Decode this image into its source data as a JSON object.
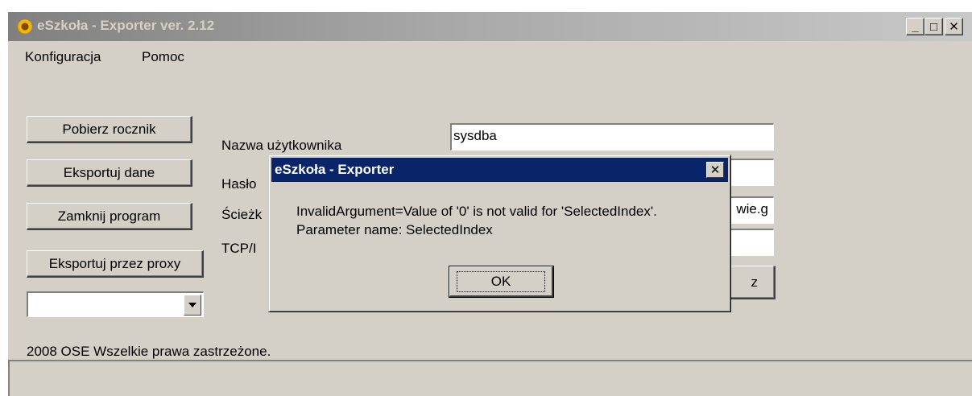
{
  "window": {
    "title": "eSzkoła - Exporter ver. 2.12",
    "icon": "sunflower-app-icon",
    "controls": {
      "minimize": "_",
      "maximize": "□",
      "close": "✕"
    }
  },
  "menu": [
    {
      "label": "Konfiguracja"
    },
    {
      "label": "Pomoc"
    }
  ],
  "buttons": {
    "fetch_year": "Pobierz rocznik",
    "export_data": "Eksportuj dane",
    "close_program": "Zamknij program",
    "export_proxy": "Eksportuj przez proxy"
  },
  "combo": {
    "value": ""
  },
  "form": {
    "username_label": "Nazwa użytkownika",
    "username_value": "sysdba",
    "password_label": "Hasło",
    "path_label": "Ścieżk",
    "path_value": "wie.g",
    "tcp_label": "TCP/I",
    "hidden_button_fragment": "z"
  },
  "footer": {
    "copyright": "2008 OSE Wszelkie prawa zastrzeżone."
  },
  "dialog": {
    "title": "eSzkoła - Exporter",
    "message_line1": "InvalidArgument=Value of '0' is not valid for 'SelectedIndex'.",
    "message_line2": "Parameter name: SelectedIndex",
    "ok_label": "OK",
    "title_color": "#0a246a"
  }
}
